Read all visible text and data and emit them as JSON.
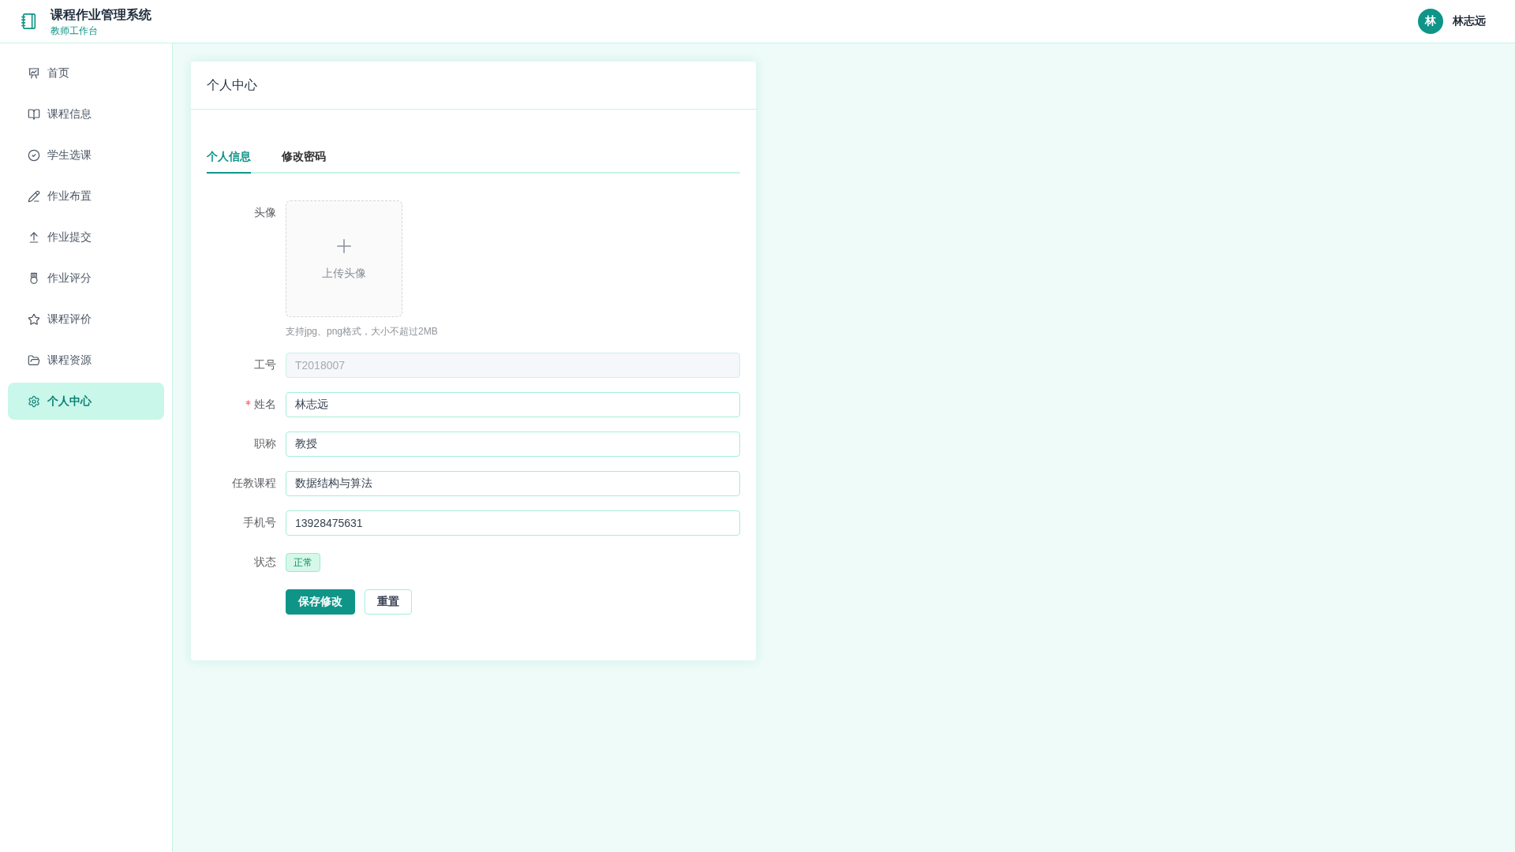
{
  "header": {
    "title": "课程作业管理系统",
    "subtitle": "教师工作台",
    "user": {
      "initial": "林",
      "name": "林志远"
    }
  },
  "sidebar": {
    "items": [
      {
        "label": "首页",
        "selected": false
      },
      {
        "label": "课程信息",
        "selected": false
      },
      {
        "label": "学生选课",
        "selected": false
      },
      {
        "label": "作业布置",
        "selected": false
      },
      {
        "label": "作业提交",
        "selected": false
      },
      {
        "label": "作业评分",
        "selected": false
      },
      {
        "label": "课程评价",
        "selected": false
      },
      {
        "label": "课程资源",
        "selected": false
      },
      {
        "label": "个人中心",
        "selected": true
      }
    ]
  },
  "card": {
    "title": "个人中心",
    "tabs": [
      {
        "label": "个人信息",
        "selected": true
      },
      {
        "label": "修改密码",
        "selected": false
      }
    ],
    "avatar": {
      "label": "头像",
      "upload_text": "上传头像",
      "hint": "支持jpg、png格式，大小不超过2MB"
    },
    "fields": [
      {
        "label": "工号",
        "value": "T2018007",
        "disabled": true,
        "required": false
      },
      {
        "label": "姓名",
        "value": "林志远",
        "disabled": false,
        "required": true
      },
      {
        "label": "职称",
        "value": "教授",
        "disabled": false,
        "required": false
      },
      {
        "label": "任教课程",
        "value": "数据结构与算法",
        "disabled": false,
        "required": false
      },
      {
        "label": "手机号",
        "value": "13928475631",
        "disabled": false,
        "required": false
      }
    ],
    "status": {
      "label": "状态",
      "value": "正常"
    },
    "buttons": [
      {
        "label": "保存修改",
        "kind": "primary"
      },
      {
        "label": "重置",
        "kind": "default"
      }
    ]
  }
}
